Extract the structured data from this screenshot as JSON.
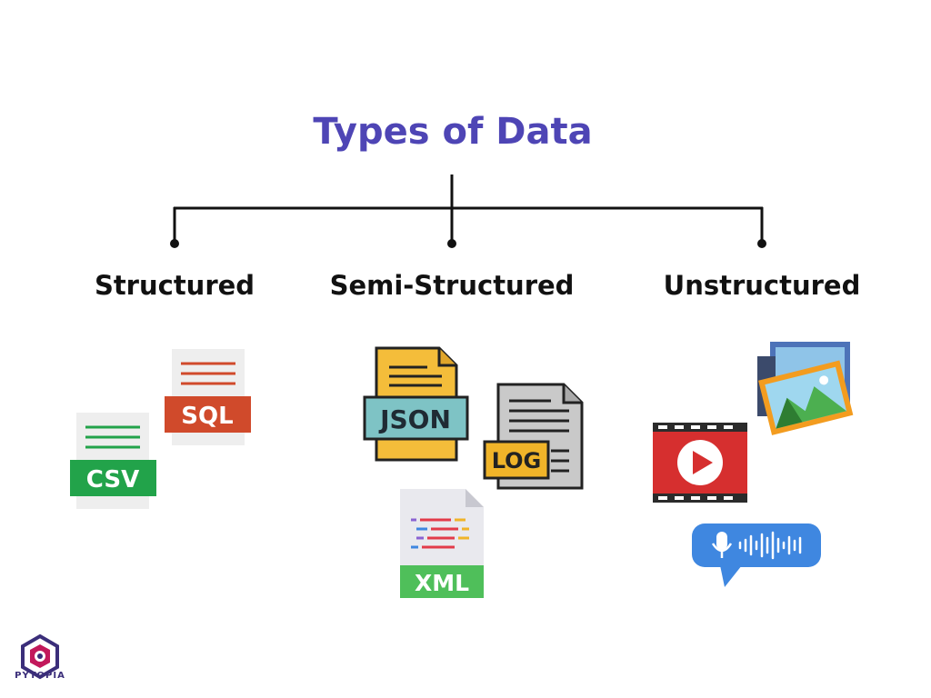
{
  "title": "Types of Data",
  "categories": {
    "structured": "Structured",
    "semi_structured": "Semi-Structured",
    "unstructured": "Unstructured"
  },
  "file_types": {
    "sql": "SQL",
    "csv": "CSV",
    "json": "JSON",
    "log": "LOG",
    "xml": "XML"
  },
  "brand": "PYTOPIA",
  "colors": {
    "title": "#4e45b5",
    "sql": "#d04a2b",
    "csv": "#22a34a",
    "json": "#7ec3c5",
    "log": "#f0b429",
    "xml": "#4fbf5a",
    "video": "#d62f2f",
    "audio": "#3f87e0"
  },
  "icons": [
    "sql-file-icon",
    "csv-file-icon",
    "json-file-icon",
    "log-file-icon",
    "xml-file-icon",
    "image-gallery-icon",
    "video-icon",
    "audio-message-icon",
    "pytopia-logo"
  ]
}
